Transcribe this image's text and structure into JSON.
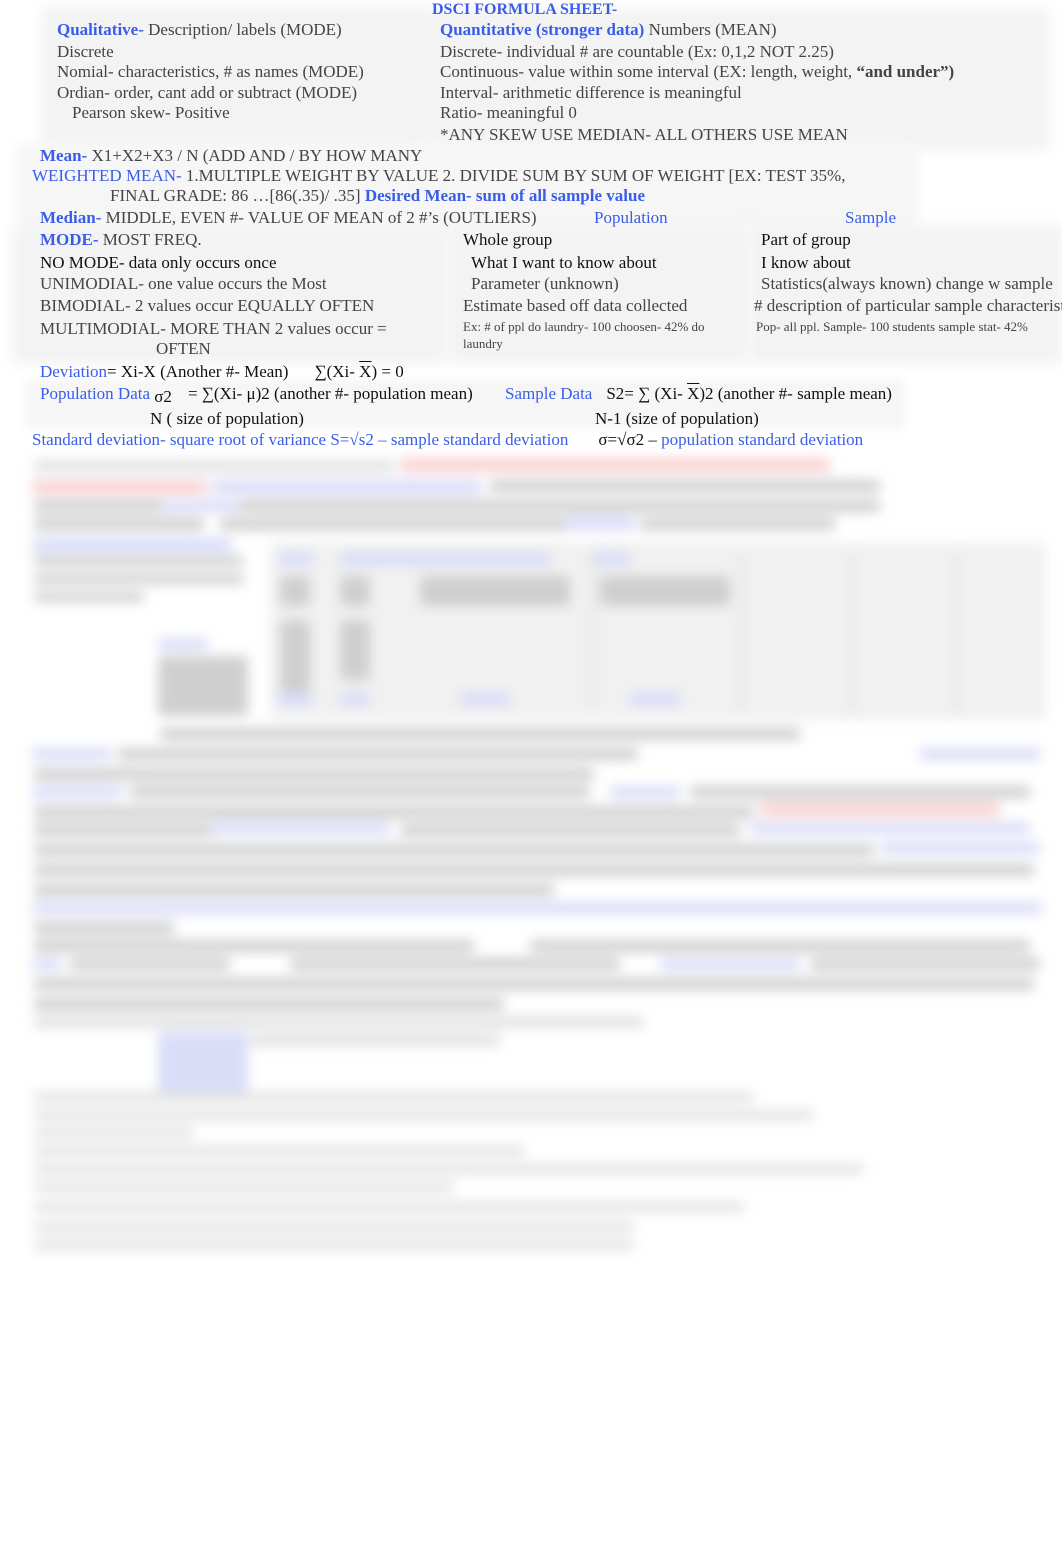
{
  "title": "DSCI FORMULA SHEET-",
  "qualitative": {
    "heading": "Qualitative-",
    "desc": " Description/ labels (MODE)",
    "lines": [
      "Discrete",
      "Nomial- characteristics, # as names (MODE)",
      "Ordian- order, cant add or subtract (MODE)",
      "Pearson skew- Positive"
    ]
  },
  "quantitative": {
    "heading": "Quantitative (stronger data)",
    "desc": " Numbers (MEAN)",
    "lines": [
      "Discrete- individual # are countable (Ex: 0,1,2 NOT 2.25)",
      "Interval- arithmetic difference is meaningful",
      "Ratio- meaningful 0",
      "*ANY SKEW USE MEDIAN- ALL OTHERS USE MEAN"
    ],
    "continuous_prefix": "Continuous- value within some interval (EX: length, weight, ",
    "continuous_bold": "“and under”)"
  },
  "mean": {
    "label": "Mean-",
    "text": " X1+X2+X3 / N   (ADD AND / BY HOW MANY"
  },
  "weighted_mean": {
    "label": "WEIGHTED MEAN-",
    "text": " 1.MULTIPLE WEIGHT BY VALUE 2. DIVIDE SUM BY SUM OF WEIGHT [EX: TEST 35%,",
    "text2": "FINAL GRADE: 86 …[86(.35)/ .35] ",
    "desired": "Desired Mean- sum of all sample value"
  },
  "median": {
    "label": "Median-",
    "text": " MIDDLE, EVEN #- VALUE OF MEAN of 2 #’s (OUTLIERS)"
  },
  "mode": {
    "label": "MODE-",
    "text": " MOST FREQ.",
    "lines": [
      "NO MODE- data only occurs once",
      "UNIMODIAL- one value occurs the Most",
      "BIMODIAL- 2 values occur EQUALLY OFTEN",
      "MULTIMODIAL- MORE THAN 2 values occur =",
      "OFTEN"
    ]
  },
  "population": {
    "heading": "Population",
    "lines": [
      "Whole group",
      "What I want to know about",
      "Parameter (unknown)",
      "Estimate based off data collected"
    ],
    "example": "Ex: # of ppl do laundry- 100 choosen- 42% do laundry"
  },
  "sample": {
    "heading": "Sample",
    "lines": [
      "Part of group",
      "I know about",
      "Statistics(always known) change w sample",
      "# description of particular sample characteristic"
    ],
    "example": "Pop- all ppl. Sample- 100  students sample stat- 42%"
  },
  "deviation": {
    "label": "Deviation",
    "text": "= Xi-X (Another #- Mean)",
    "formula_a": "∑(Xi- ",
    "xbar": "X",
    "formula_b": ") = 0"
  },
  "population_data": {
    "label": "Population Data",
    "sigma": "σ2",
    "formula_a": "= ∑(Xi- ",
    "mu": "μ",
    "formula_b": ")2 (another #- population mean)",
    "denominator": "N ( size of population)"
  },
  "sample_data": {
    "label": "Sample Data",
    "formula_a": "S2=  ∑ (Xi- ",
    "xbar": "X",
    "formula_b": ")2 (another #- sample mean)",
    "denominator": "N-1   (size of population)"
  },
  "std_dev": {
    "label": "Standard deviation- square root of variance",
    "sample_formula": " S=√s2 – ",
    "sample_text": "sample standard deviation",
    "pop_formula": "σ=√σ2 – ",
    "pop_text": "population standard deviation"
  }
}
